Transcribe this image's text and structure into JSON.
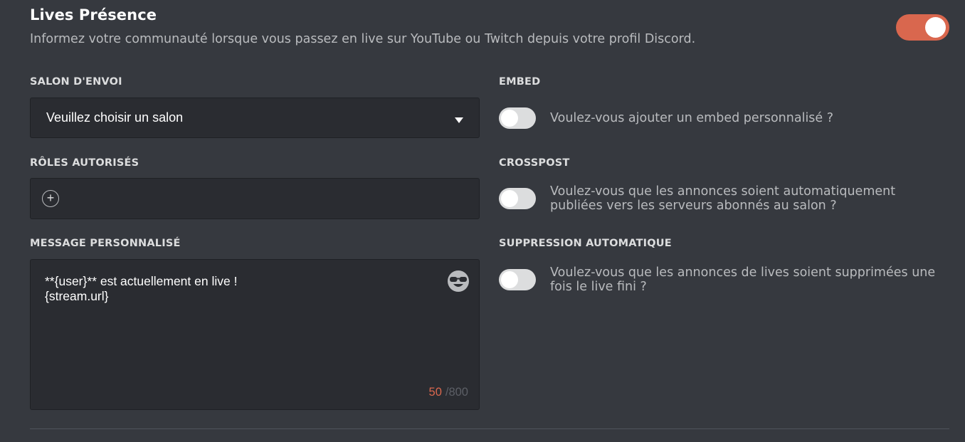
{
  "header": {
    "title": "Lives Présence",
    "description": "Informez votre communauté lorsque vous passez en live sur YouTube ou Twitch depuis votre profil Discord.",
    "enabled": true
  },
  "channel": {
    "label": "SALON D'ENVOI",
    "value": "Veuillez choisir un salon"
  },
  "roles": {
    "label": "RÔLES AUTORISÉS",
    "add_icon": "+"
  },
  "message": {
    "label": "MESSAGE PERSONNALISÉ",
    "value": "**{user}** est actuellement en live !\n{stream.url}",
    "count": "50",
    "max": "/800"
  },
  "embed": {
    "label": "EMBED",
    "description": "Voulez-vous ajouter un embed personnalisé ?",
    "enabled": false
  },
  "crosspost": {
    "label": "CROSSPOST",
    "description": "Voulez-vous que les annonces soient automatiquement publiées vers les serveurs abonnés au salon ?",
    "enabled": false
  },
  "auto_delete": {
    "label": "SUPPRESSION AUTOMATIQUE",
    "description": "Voulez-vous que les annonces de lives soient supprimées une fois le live fini ?",
    "enabled": false
  },
  "colors": {
    "accent": "#d9674e",
    "background": "#36393f",
    "input_background": "#2a2c31"
  }
}
